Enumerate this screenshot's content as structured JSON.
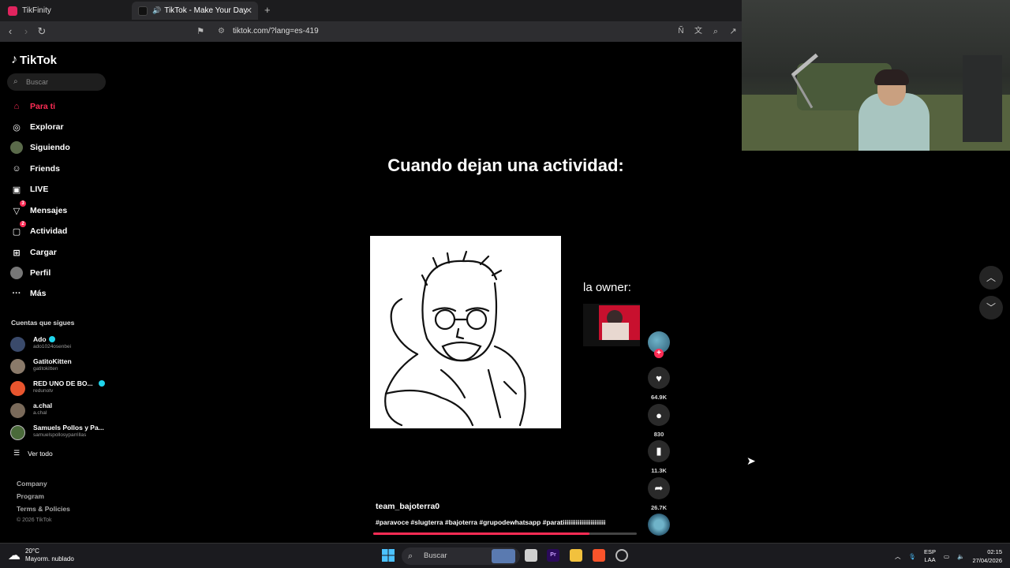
{
  "browser": {
    "tabs": [
      {
        "label": "TikFinity",
        "active": false
      },
      {
        "label": "TikTok - Make Your Day",
        "active": true
      }
    ],
    "url": "tiktok.com/?lang=es-419"
  },
  "sidebar": {
    "logo": "TikTok",
    "search_placeholder": "Buscar",
    "nav": [
      {
        "label": "Para ti",
        "icon": "home-icon",
        "active": true
      },
      {
        "label": "Explorar",
        "icon": "compass-icon"
      },
      {
        "label": "Siguiendo",
        "icon": "following-icon"
      },
      {
        "label": "Friends",
        "icon": "friends-icon"
      },
      {
        "label": "LIVE",
        "icon": "live-icon"
      },
      {
        "label": "Mensajes",
        "icon": "messages-icon",
        "badge": "3"
      },
      {
        "label": "Actividad",
        "icon": "activity-icon",
        "badge": "2"
      },
      {
        "label": "Cargar",
        "icon": "upload-icon"
      },
      {
        "label": "Perfil",
        "icon": "profile-icon"
      },
      {
        "label": "Más",
        "icon": "more-icon"
      }
    ],
    "following_title": "Cuentas que sigues",
    "following": [
      {
        "name": "Ado",
        "handle": "ado1024osenbei",
        "verified": true,
        "color": "#3a4a6b"
      },
      {
        "name": "GatitoKitten",
        "handle": "gatitokitten",
        "verified": false,
        "color": "#8a7a6a"
      },
      {
        "name": "RED UNO DE BO...",
        "handle": "redunotv",
        "verified": true,
        "color": "#e8552e"
      },
      {
        "name": "a.chal",
        "handle": "a.chal",
        "verified": false,
        "color": "#7a6a5a"
      },
      {
        "name": "Samuels Pollos y Pa...",
        "handle": "samuelspollosyparrillas",
        "verified": false,
        "color": "#4a6a3a"
      }
    ],
    "see_all": "Ver todo",
    "footer": [
      "Company",
      "Program",
      "Terms & Policies"
    ],
    "copyright": "© 2026 TikTok"
  },
  "video": {
    "caption": "Cuando dejan una actividad:",
    "owner_label": "la owner:",
    "author": "team_bajoterra0",
    "hashtags": "#paravoce #slugterra #bajoterra #grupodewhatsapp #paratiiiiiiiiiiiiiiiiiiiiiii",
    "progress_percent": 82
  },
  "actions": {
    "likes": "64.9K",
    "comments": "830",
    "saves": "11.3K",
    "shares": "26.7K"
  },
  "taskbar": {
    "temperature": "20°C",
    "weather": "Mayorm. nublado",
    "search_placeholder": "Buscar",
    "lang_top": "ESP",
    "lang_bottom": "LAA",
    "time": "02:15",
    "date": "27/04/2026"
  }
}
